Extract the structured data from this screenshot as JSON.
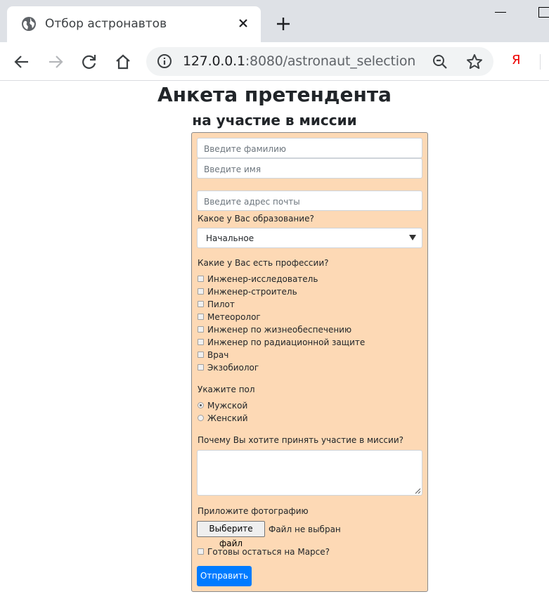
{
  "browser": {
    "tab_title": "Отбор астронавтов",
    "url_host": "127.0.0.1",
    "url_rest": ":8080/astronaut_selection",
    "yandex_label": "Я",
    "icons": [
      "globe-icon",
      "close-icon",
      "plus-icon",
      "back-icon",
      "forward-icon",
      "reload-icon",
      "home-icon",
      "info-icon",
      "zoom-icon",
      "star-icon"
    ]
  },
  "page": {
    "title": "Анкета претендента",
    "subtitle": "на участие в миссии"
  },
  "form": {
    "surname_placeholder": "Введите фамилию",
    "name_placeholder": "Введите имя",
    "email_placeholder": "Введите адрес почты",
    "education_label": "Какое у Вас образование?",
    "education_value": "Начальное",
    "professions_label": "Какие у Вас есть профессии?",
    "professions": [
      "Инженер-исследователь",
      "Инженер-строитель",
      "Пилот",
      "Метеоролог",
      "Инженер по жизнеобеспечению",
      "Инженер по радиационной защите",
      "Врач",
      "Экзобиолог"
    ],
    "sex_label": "Укажите пол",
    "sex_options": [
      "Мужской",
      "Женский"
    ],
    "sex_selected": "Мужской",
    "motivation_label": "Почему Вы хотите принять участие в миссии?",
    "photo_label": "Приложите фотографию",
    "file_button": "Выберите файл",
    "file_status": "Файл не выбран",
    "stay_label": "Готовы остаться на Марсе?",
    "submit_label": "Отправить"
  },
  "colors": {
    "form_bg": "#fdd9b5",
    "accent": "#007bff",
    "tabbar_bg": "#dee1e6"
  }
}
